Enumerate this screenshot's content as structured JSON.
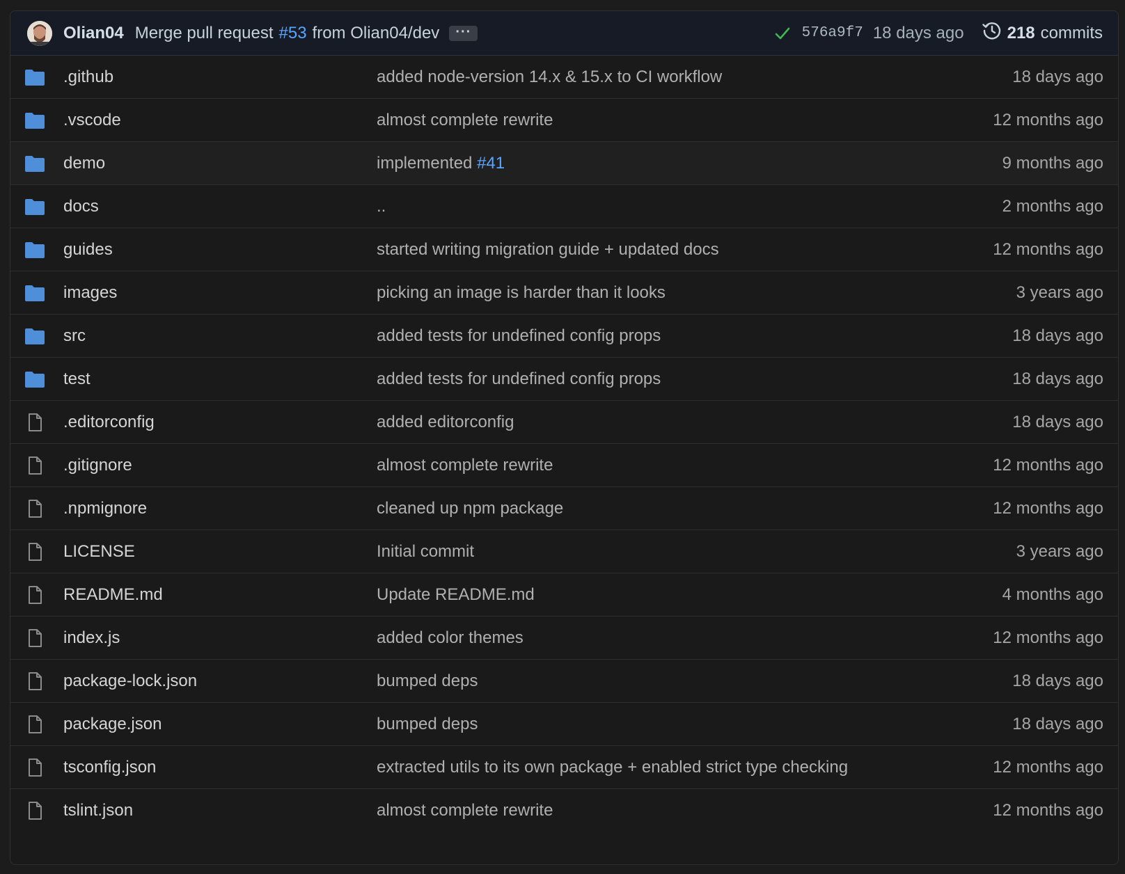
{
  "header": {
    "author": "Olian04",
    "message_prefix": "Merge pull request",
    "pr_ref": "#53",
    "message_suffix": "from Olian04/dev",
    "ellipsis": "···",
    "status_icon": "check-icon",
    "sha": "576a9f7",
    "date": "18 days ago",
    "commit_count": "218",
    "commits_label": "commits",
    "colors": {
      "accent_link": "#58a6ff",
      "success": "#3fb950",
      "folder": "#4f8fd9"
    }
  },
  "files": [
    {
      "type": "dir",
      "name": ".github",
      "message": "added node-version 14.x & 15.x to CI workflow",
      "age": "18 days ago"
    },
    {
      "type": "dir",
      "name": ".vscode",
      "message": "almost complete rewrite",
      "age": "12 months ago"
    },
    {
      "type": "dir",
      "name": "demo",
      "message": "implemented",
      "message_link": "#41",
      "age": "9 months ago"
    },
    {
      "type": "dir",
      "name": "docs",
      "message": "..",
      "age": "2 months ago"
    },
    {
      "type": "dir",
      "name": "guides",
      "message": "started writing migration guide + updated docs",
      "age": "12 months ago"
    },
    {
      "type": "dir",
      "name": "images",
      "message": "picking an image is harder than it looks",
      "age": "3 years ago"
    },
    {
      "type": "dir",
      "name": "src",
      "message": "added tests for undefined config props",
      "age": "18 days ago"
    },
    {
      "type": "dir",
      "name": "test",
      "message": "added tests for undefined config props",
      "age": "18 days ago"
    },
    {
      "type": "file",
      "name": ".editorconfig",
      "message": "added editorconfig",
      "age": "18 days ago"
    },
    {
      "type": "file",
      "name": ".gitignore",
      "message": "almost complete rewrite",
      "age": "12 months ago"
    },
    {
      "type": "file",
      "name": ".npmignore",
      "message": "cleaned up npm package",
      "age": "12 months ago"
    },
    {
      "type": "file",
      "name": "LICENSE",
      "message": "Initial commit",
      "age": "3 years ago"
    },
    {
      "type": "file",
      "name": "README.md",
      "message": "Update README.md",
      "age": "4 months ago"
    },
    {
      "type": "file",
      "name": "index.js",
      "message": "added color themes",
      "age": "12 months ago"
    },
    {
      "type": "file",
      "name": "package-lock.json",
      "message": "bumped deps",
      "age": "18 days ago"
    },
    {
      "type": "file",
      "name": "package.json",
      "message": "bumped deps",
      "age": "18 days ago"
    },
    {
      "type": "file",
      "name": "tsconfig.json",
      "message": "extracted utils to its own package + enabled strict type checking",
      "age": "12 months ago"
    },
    {
      "type": "file",
      "name": "tslint.json",
      "message": "almost complete rewrite",
      "age": "12 months ago"
    }
  ]
}
